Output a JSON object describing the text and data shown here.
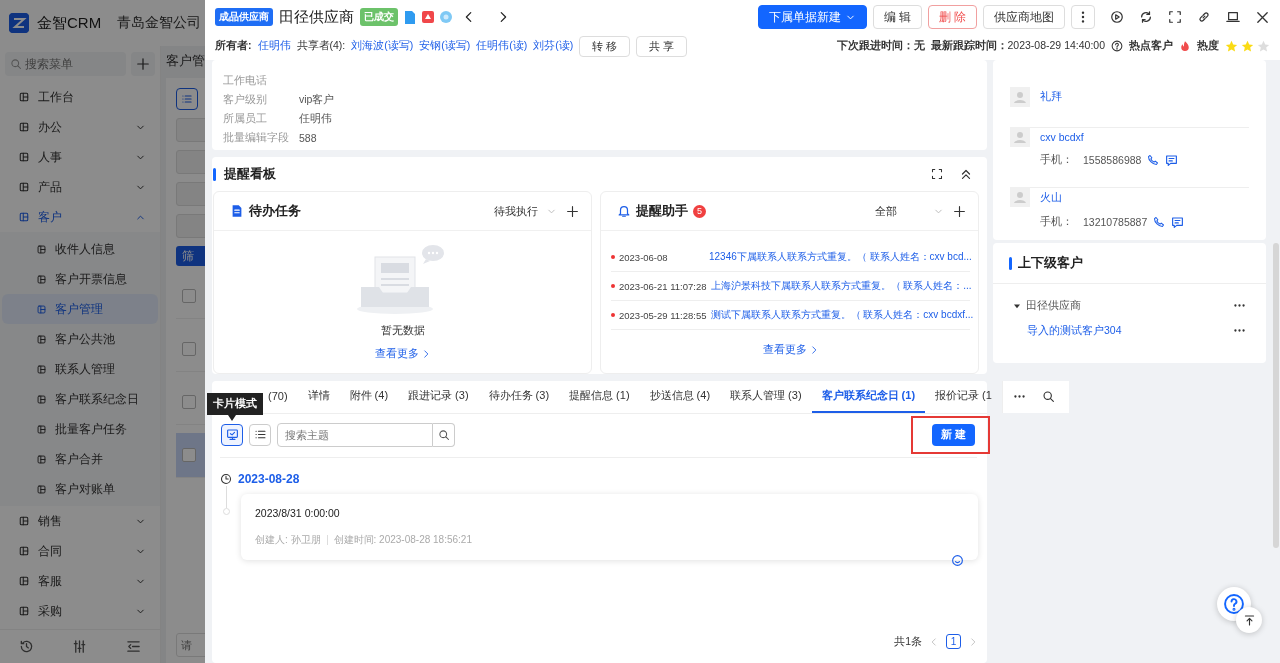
{
  "background_app": {
    "logo": "金智CRM",
    "company": "青岛金智公司",
    "search": {
      "placeholder": "搜索菜单"
    },
    "menu": [
      {
        "label": "工作台",
        "kind": "link"
      },
      {
        "label": "办公",
        "kind": "group",
        "expanded": false
      },
      {
        "label": "人事",
        "kind": "group",
        "expanded": false
      },
      {
        "label": "产品",
        "kind": "group",
        "expanded": false
      },
      {
        "label": "客户",
        "kind": "group",
        "expanded": true,
        "children": [
          {
            "label": "收件人信息",
            "selected": false
          },
          {
            "label": "客户开票信息",
            "selected": false
          },
          {
            "label": "客户管理",
            "selected": true
          },
          {
            "label": "客户公共池",
            "selected": false
          },
          {
            "label": "联系人管理",
            "selected": false
          },
          {
            "label": "客户联系纪念日",
            "selected": false
          },
          {
            "label": "批量客户任务",
            "selected": false
          },
          {
            "label": "客户合并",
            "selected": false
          },
          {
            "label": "客户对账单",
            "selected": false
          }
        ]
      },
      {
        "label": "销售",
        "kind": "group",
        "expanded": false
      },
      {
        "label": "合同",
        "kind": "group",
        "expanded": false
      },
      {
        "label": "客服",
        "kind": "group",
        "expanded": false
      },
      {
        "label": "采购",
        "kind": "group",
        "expanded": false
      }
    ],
    "page_title": "客户管",
    "filter_button": "筛",
    "rows": [
      {
        "checked": false,
        "selected": false
      },
      {
        "checked": false,
        "selected": false
      },
      {
        "checked": false,
        "selected": false
      },
      {
        "checked": false,
        "selected": true
      }
    ],
    "pager_field": {
      "placeholder": "请"
    }
  },
  "record": {
    "type_tag": "成品供应商",
    "title": "田径供应商",
    "status_tag": "已成交",
    "actions": [
      {
        "label": "下属单据新建",
        "kind": "primary"
      },
      {
        "label": "编 辑",
        "kind": "default"
      },
      {
        "label": "删 除",
        "kind": "danger"
      },
      {
        "label": "供应商地图",
        "kind": "default"
      }
    ],
    "owner_label": "所有者:",
    "owner": "任明伟",
    "sharers_label": "共享者(4):",
    "sharers": [
      "刘海波(读写)",
      "安钢(读写)",
      "任明伟(读)",
      "刘芬(读)"
    ],
    "share_buttons": [
      "转 移",
      "共 享"
    ],
    "next_follow": "下次跟进时间：无",
    "last_track": "**最新跟踪时间：**2023-08-29 14:40:00",
    "hot_label": "热点客户",
    "heat_label": "热度",
    "stars": 2
  },
  "info_fields": [
    {
      "label": "工作电话"
    },
    {
      "label": "客户级别",
      "value": "vip客户"
    },
    {
      "label": "所属员工",
      "value": "任明伟"
    },
    {
      "label": "批量编辑字段",
      "value": "588"
    }
  ],
  "board": {
    "title": "提醒看板",
    "tasks": {
      "title": "待办任务",
      "filter": "待我执行",
      "empty_text": "暂无数据",
      "more": "查看更多"
    },
    "reminders": {
      "title": "提醒助手",
      "badge": "5",
      "filter": "全部",
      "more": "查看更多",
      "items": [
        {
          "date": "2023-06-08",
          "text": "12346下属联系人联系方式重复。（ 联系人姓名：cxv bcd..."
        },
        {
          "date": "2023-06-21 11:07:28",
          "text": "上海沪景科技下属联系人联系方式重复。（ 联系人姓名：..."
        },
        {
          "date": "2023-05-29 11:28:55",
          "text": "测试下属联系人联系方式重复。（ 联系人姓名：cxv bcdxf..."
        }
      ]
    }
  },
  "tabs": [
    {
      "label": "(70)",
      "selected": false
    },
    {
      "label": "详情",
      "selected": false
    },
    {
      "label": "附件 (4)",
      "selected": false
    },
    {
      "label": "跟进记录 (3)",
      "selected": false
    },
    {
      "label": "待办任务 (3)",
      "selected": false
    },
    {
      "label": "提醒信息 (1)",
      "selected": false
    },
    {
      "label": "抄送信息 (4)",
      "selected": false
    },
    {
      "label": "联系人管理 (3)",
      "selected": false
    },
    {
      "label": "客户联系纪念日 (1)",
      "selected": true
    },
    {
      "label": "报价记录 (1",
      "selected": false
    }
  ],
  "tooltip": "卡片模式",
  "view_modes": [
    {
      "kind": "card",
      "selected": true
    },
    {
      "kind": "list",
      "selected": false
    }
  ],
  "search": {
    "placeholder": "搜索主题"
  },
  "new_button": "新 建",
  "timeline": [
    {
      "date": "2023-08-28",
      "entries": [
        {
          "title": "2023/8/31 0:00:00",
          "creator": "创建人: 孙卫朋",
          "created": "创建时间: 2023-08-28 18:56:21"
        }
      ]
    }
  ],
  "pagination": {
    "total": "共1条",
    "pages": [
      {
        "label": "1",
        "selected": true
      }
    ]
  },
  "contacts": [
    {
      "name": "礼拜"
    },
    {
      "name": "cxv bcdxf",
      "phone_label": "手机：",
      "phone": "1558586988"
    },
    {
      "name": "火山",
      "phone_label": "手机：",
      "phone": "13210785887"
    }
  ],
  "hierarchy": {
    "title": "上下级客户",
    "tree": [
      {
        "label": "田径供应商",
        "expanded": true,
        "children": [
          {
            "label": "导入的测试客户304"
          }
        ]
      }
    ]
  }
}
